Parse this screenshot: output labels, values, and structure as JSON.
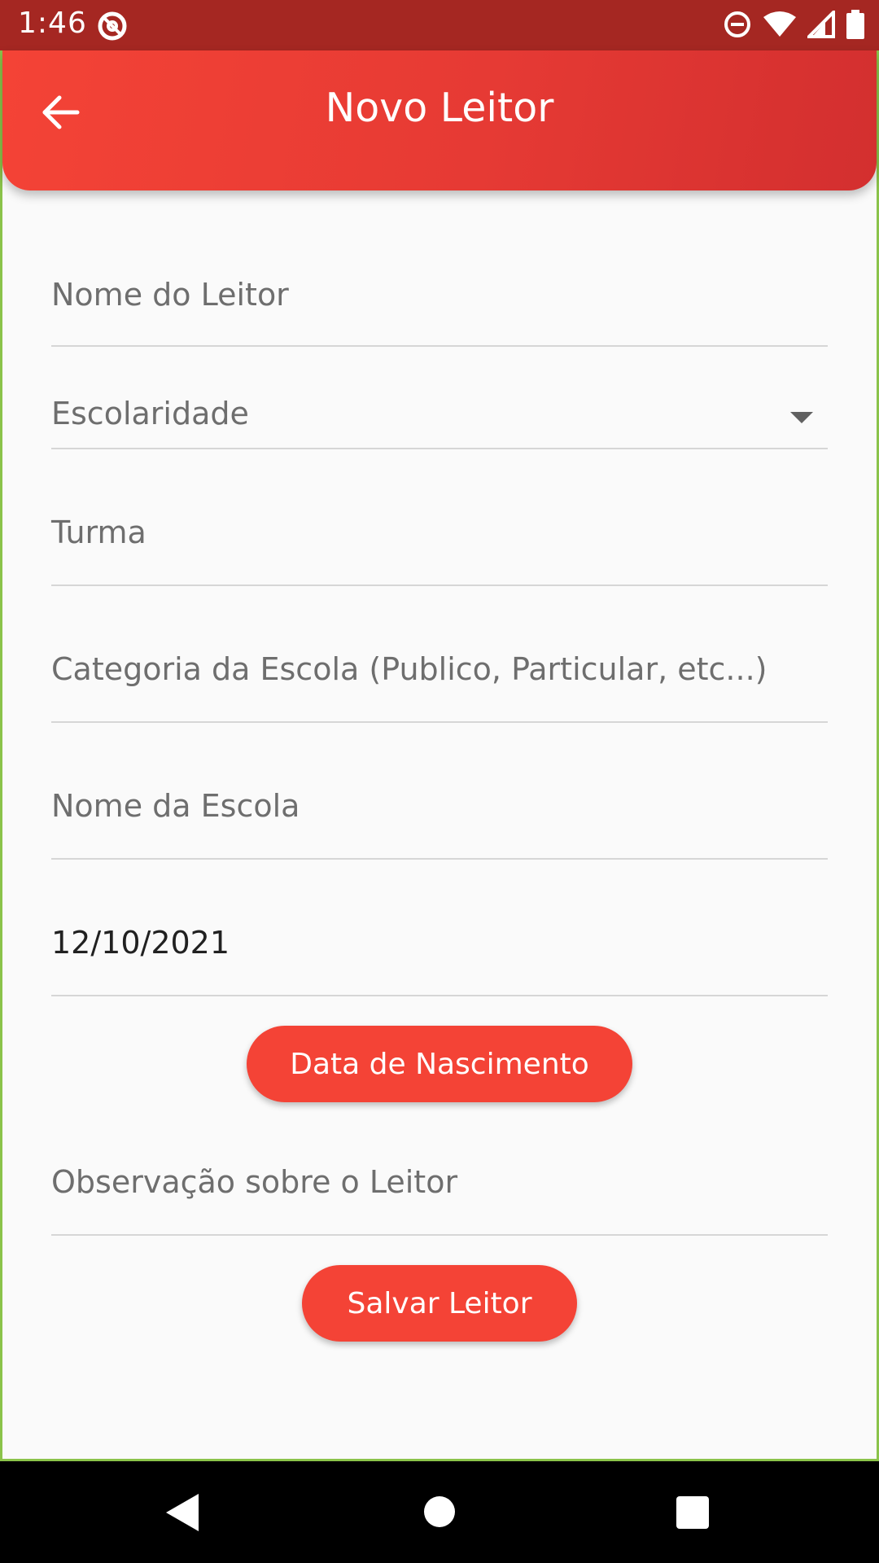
{
  "status_bar": {
    "time": "1:46",
    "icons": [
      "at-sign-icon",
      "do-not-disturb-icon",
      "wifi-icon",
      "cell-signal-icon",
      "battery-icon"
    ]
  },
  "app_bar": {
    "title": "Novo Leitor",
    "back_icon": "arrow-back-icon",
    "color_start": "#f44336",
    "color_end": "#d32f2f"
  },
  "form": {
    "reader_name_placeholder": "Nome do Leitor",
    "education_placeholder": "Escolaridade",
    "class_placeholder": "Turma",
    "school_category_placeholder": "Categoria da Escola (Publico, Particular, etc...)",
    "school_name_placeholder": "Nome da Escola",
    "birth_date_value": "12/10/2021",
    "birth_date_button": "Data de Nascimento",
    "notes_placeholder": "Observação sobre o Leitor",
    "save_button": "Salvar Leitor"
  },
  "nav_bar": {
    "icons": [
      "nav-back-icon",
      "nav-home-icon",
      "nav-recents-icon"
    ]
  }
}
